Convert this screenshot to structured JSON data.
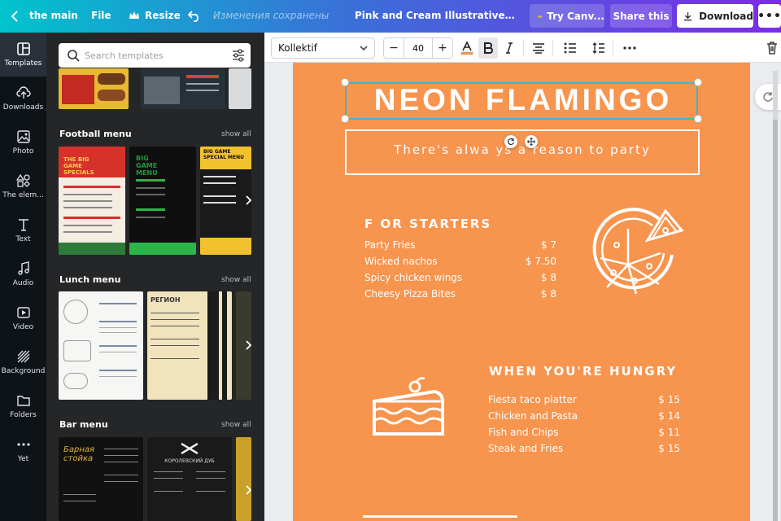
{
  "topbar": {
    "home": "the main",
    "file": "File",
    "resize": "Resize",
    "saved_status": "Изменения сохранены",
    "doc_title": "Pink and Cream Illustrative Restaura...",
    "try": "Try Canv...",
    "share": "Share this",
    "download": "Download",
    "more": "•••"
  },
  "rail": {
    "items": [
      {
        "label": "Templates",
        "icon": "templates-icon"
      },
      {
        "label": "Downloads",
        "icon": "upload-cloud-icon"
      },
      {
        "label": "Photo",
        "icon": "photo-icon"
      },
      {
        "label": "The elem...",
        "icon": "shapes-icon"
      },
      {
        "label": "Text",
        "icon": "text-icon"
      },
      {
        "label": "Audio",
        "icon": "music-note-icon"
      },
      {
        "label": "Video",
        "icon": "video-icon"
      },
      {
        "label": "Background",
        "icon": "background-icon"
      },
      {
        "label": "Folders",
        "icon": "folder-icon"
      },
      {
        "label": "Yet",
        "icon": "more-dots-icon"
      }
    ]
  },
  "panel": {
    "search_placeholder": "Search templates",
    "sections": [
      {
        "title": "Football menu",
        "show_all": "show all"
      },
      {
        "title": "Lunch menu",
        "show_all": "show all"
      },
      {
        "title": "Bar menu",
        "show_all": "show all"
      }
    ],
    "thumb_text": {
      "football_1": "THE BIG GAME SPECIALS",
      "football_2": "BIG GAME MENU",
      "football_3": "BIG GAME SPECIAL MENU",
      "lunch_2": "РЕГИОН",
      "bar_1": "Барная стойка",
      "bar_2": "КОРОЛЕВСКИЙ ДУБ"
    }
  },
  "toolbar": {
    "font": "Kollektif",
    "size": "40",
    "minus": "−",
    "plus": "+"
  },
  "page": {
    "title": "NEON FLAMINGO",
    "subtitle": "There's alwa ys a reason to party",
    "starters": {
      "heading": "F OR STARTERS",
      "items": [
        {
          "name": "Party Fries",
          "price": "$ 7"
        },
        {
          "name": "Wicked nachos",
          "price": "$ 7.50"
        },
        {
          "name": "Spicy chicken wings",
          "price": "$ 8"
        },
        {
          "name": "Cheesy Pizza Bites",
          "price": "$ 8"
        }
      ]
    },
    "hungry": {
      "heading": "WHEN YOU'RE HUNGRY",
      "items": [
        {
          "name": "Fiesta taco platter",
          "price": "$ 15"
        },
        {
          "name": "Chicken and Pasta",
          "price": "$ 14"
        },
        {
          "name": "Fish and Chips",
          "price": "$ 11"
        },
        {
          "name": "Steak and Fries",
          "price": "$ 15"
        }
      ]
    }
  },
  "colors": {
    "page_bg": "#f7944e",
    "panel_bg": "#252627",
    "rail_bg": "#0e1318",
    "selection": "#3fb7c5"
  }
}
